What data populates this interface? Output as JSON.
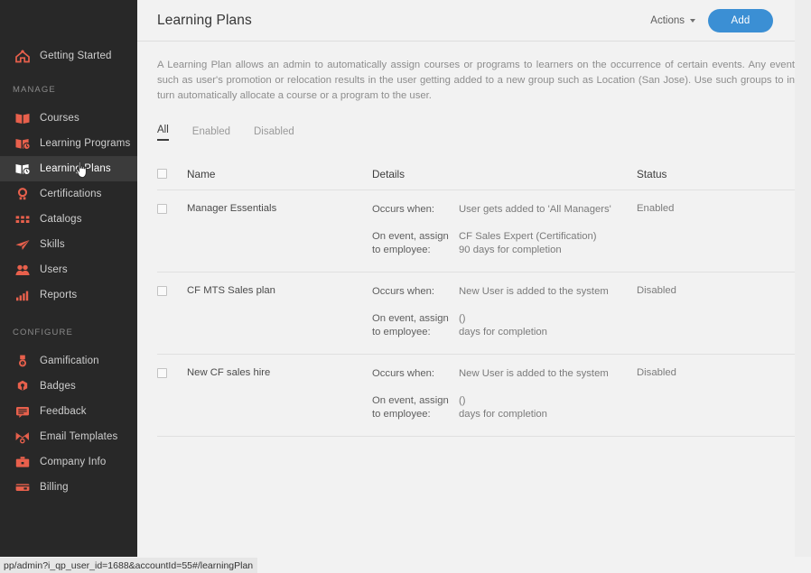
{
  "sidebar": {
    "top_items": [
      {
        "label": "Getting Started",
        "icon": "home-icon"
      }
    ],
    "sections": [
      {
        "title": "MANAGE",
        "items": [
          {
            "label": "Courses",
            "icon": "book-icon"
          },
          {
            "label": "Learning Programs",
            "icon": "program-icon"
          },
          {
            "label": "Learning Plans",
            "icon": "plan-icon",
            "active": true
          },
          {
            "label": "Certifications",
            "icon": "certification-icon"
          },
          {
            "label": "Catalogs",
            "icon": "grid-icon"
          },
          {
            "label": "Skills",
            "icon": "paper-plane-icon"
          },
          {
            "label": "Users",
            "icon": "users-icon"
          },
          {
            "label": "Reports",
            "icon": "bar-chart-icon"
          }
        ]
      },
      {
        "title": "CONFIGURE",
        "items": [
          {
            "label": "Gamification",
            "icon": "medal-icon"
          },
          {
            "label": "Badges",
            "icon": "badge-icon"
          },
          {
            "label": "Feedback",
            "icon": "feedback-icon"
          },
          {
            "label": "Email Templates",
            "icon": "envelope-icon"
          },
          {
            "label": "Company Info",
            "icon": "briefcase-icon"
          },
          {
            "label": "Billing",
            "icon": "wallet-icon"
          }
        ]
      }
    ]
  },
  "header": {
    "title": "Learning Plans",
    "actions_label": "Actions",
    "add_label": "Add"
  },
  "description": "A Learning Plan allows an admin to automatically assign courses or programs to learners on the occurrence of certain events. Any event such as user's promotion or relocation results in the user getting added to a new group such as Location (San Jose). Use such groups to in turn automatically allocate a course or a program to the user.",
  "tabs": [
    {
      "label": "All",
      "active": true
    },
    {
      "label": "Enabled",
      "active": false
    },
    {
      "label": "Disabled",
      "active": false
    }
  ],
  "table": {
    "columns": {
      "name": "Name",
      "details": "Details",
      "status": "Status"
    },
    "detail_labels": {
      "occurs_when": "Occurs when:",
      "on_event": "On event, assign to employee:"
    },
    "rows": [
      {
        "name": "Manager Essentials",
        "occurs_when": "User gets added to 'All Managers'",
        "assign_line1": "CF Sales Expert (Certification)",
        "assign_line2": "90 days for completion",
        "status": "Enabled"
      },
      {
        "name": "CF MTS Sales plan",
        "occurs_when": "New User is added to the system",
        "assign_line1": "()",
        "assign_line2": "days for completion",
        "status": "Disabled"
      },
      {
        "name": "New CF sales hire",
        "occurs_when": "New User is added to the system",
        "assign_line1": "()",
        "assign_line2": "days for completion",
        "status": "Disabled"
      }
    ]
  },
  "statusbar": {
    "url": "pp/admin?i_qp_user_id=1688&accountId=55#/learningPlan"
  },
  "colors": {
    "sidebar_bg": "#282828",
    "sidebar_active_bg": "#3b3b3b",
    "accent_icon": "#e8604c",
    "add_button": "#3b8fd4",
    "content_bg": "#f2f2f2"
  }
}
